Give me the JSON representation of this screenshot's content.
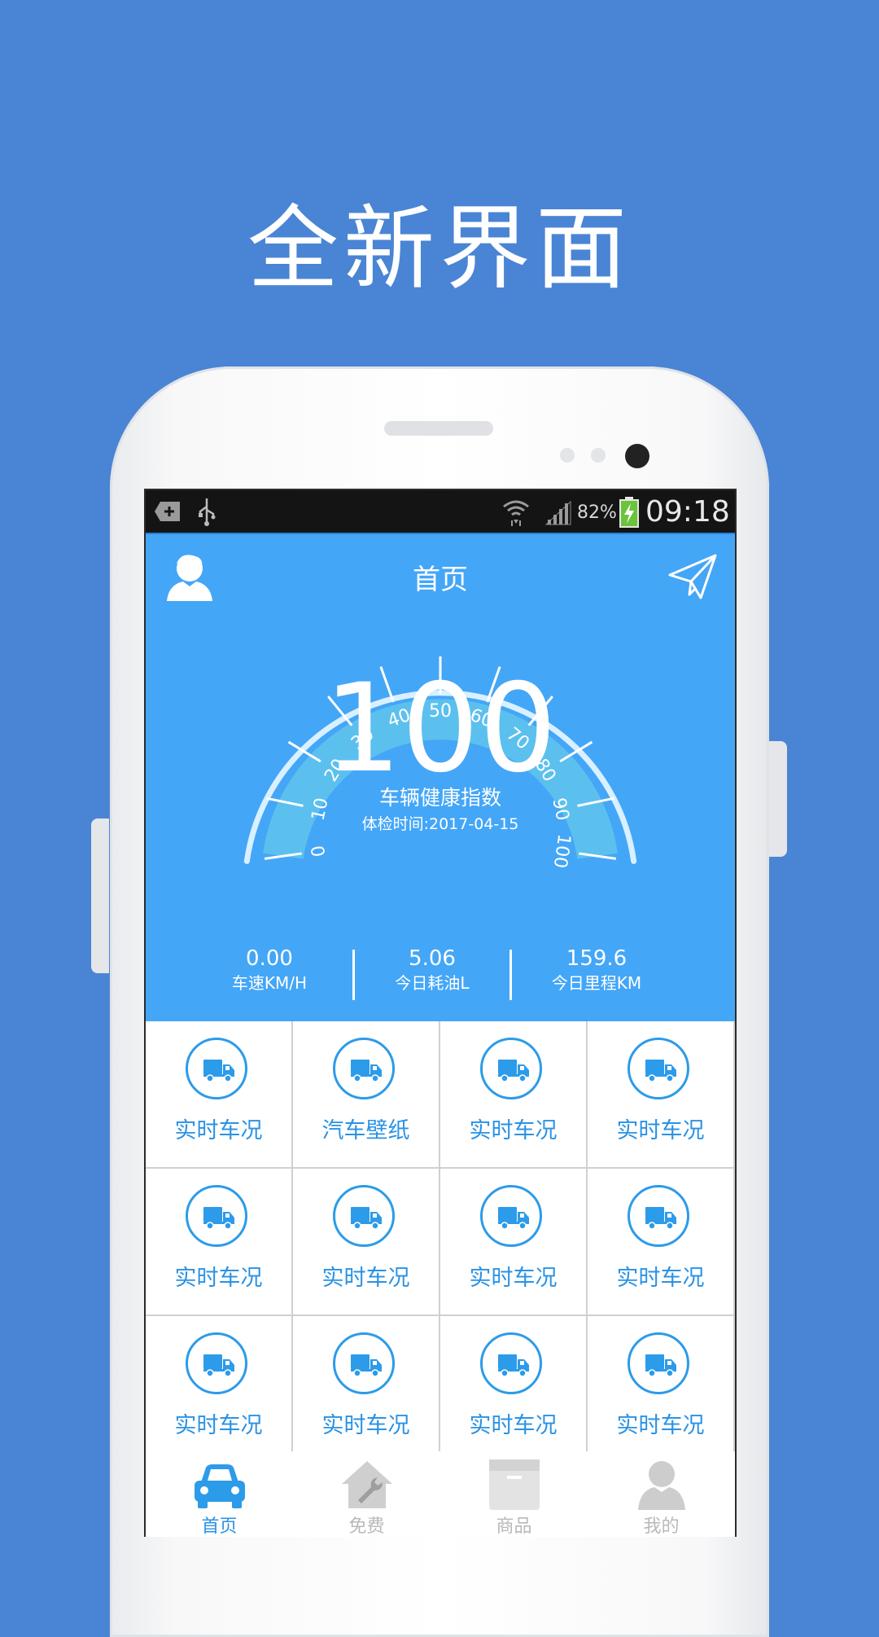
{
  "promo": {
    "headline": "全新界面"
  },
  "status_bar": {
    "battery_percent": "82%",
    "time": "09:18"
  },
  "header": {
    "title": "首页"
  },
  "gauge": {
    "score": "100",
    "label": "车辆健康指数",
    "checkup": "体检时间:2017-04-15",
    "ticks": [
      "0",
      "10",
      "20",
      "30",
      "40",
      "50",
      "60",
      "70",
      "80",
      "90",
      "100"
    ],
    "value": 100
  },
  "stats": [
    {
      "value": "0.00",
      "label": "车速KM/H"
    },
    {
      "value": "5.06",
      "label": "今日耗油L"
    },
    {
      "value": "159.6",
      "label": "今日里程KM"
    }
  ],
  "grid_items": [
    "实时车况",
    "汽车壁纸",
    "实时车况",
    "实时车况",
    "实时车况",
    "实时车况",
    "实时车况",
    "实时车况",
    "实时车况",
    "实时车况",
    "实时车况",
    "实时车况"
  ],
  "tabs": [
    {
      "label": "首页",
      "icon": "car-icon",
      "active": true
    },
    {
      "label": "免费",
      "icon": "house-wrench-icon",
      "active": false
    },
    {
      "label": "商品",
      "icon": "box-icon",
      "active": false
    },
    {
      "label": "我的",
      "icon": "person-icon",
      "active": false
    }
  ],
  "colors": {
    "background": "#4a84d4",
    "hero": "#44a6f7",
    "accent": "#2a92e4",
    "gauge_band": "#5cc0ef"
  }
}
